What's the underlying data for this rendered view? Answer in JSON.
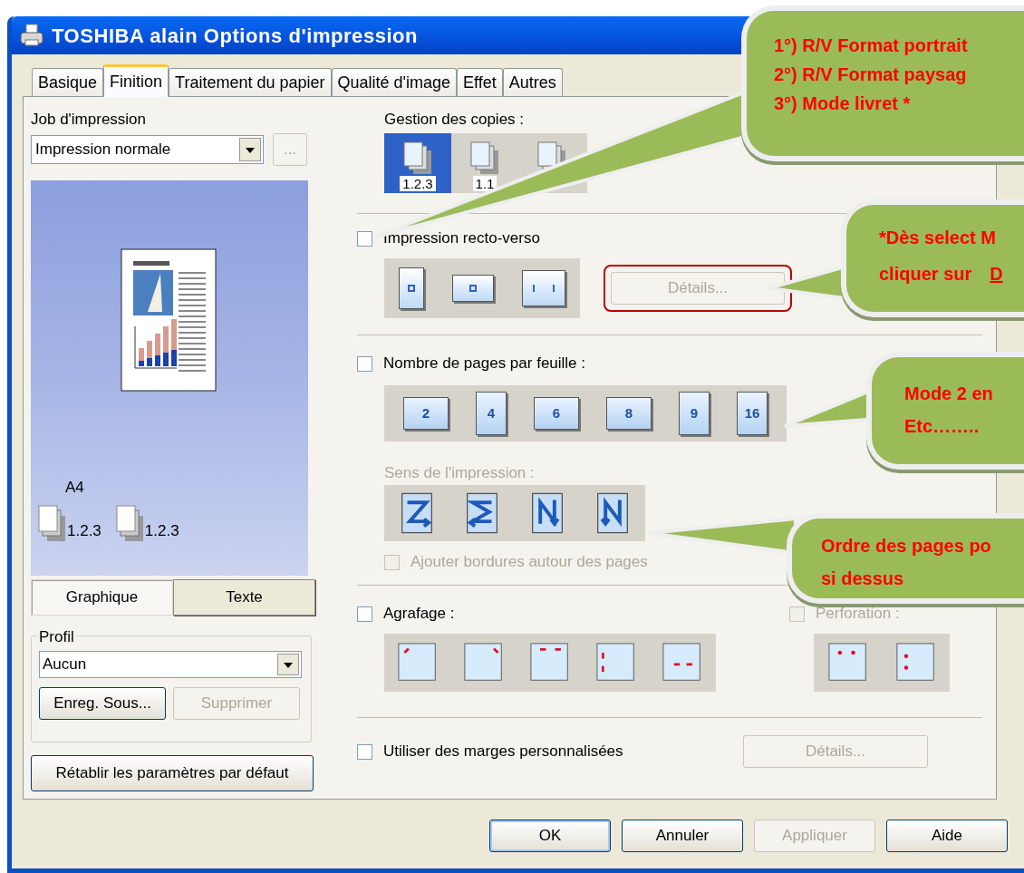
{
  "window": {
    "title": "TOSHIBA alain Options d'impression"
  },
  "tabs": [
    {
      "label": "Basique",
      "selected": false
    },
    {
      "label": "Finition",
      "selected": true
    },
    {
      "label": "Traitement du papier",
      "selected": false
    },
    {
      "label": "Qualité d'image",
      "selected": false
    },
    {
      "label": "Effet",
      "selected": false
    },
    {
      "label": "Autres",
      "selected": false
    }
  ],
  "job": {
    "label": "Job d'impression",
    "value": "Impression normale",
    "more_button": {
      "label": "...",
      "disabled": true
    }
  },
  "preview": {
    "paper_size": "A4",
    "copy_labels": [
      "1.2.3",
      "1.2.3"
    ]
  },
  "view_tabs": [
    {
      "label": "Graphique",
      "selected": true
    },
    {
      "label": "Texte",
      "selected": false
    }
  ],
  "profile": {
    "label": "Profil",
    "value": "Aucun",
    "buttons": [
      {
        "label": "Enreg. Sous...",
        "disabled": false
      },
      {
        "label": "Supprimer",
        "disabled": true
      }
    ]
  },
  "reset_button": {
    "label": "Rétablir les paramètres par défaut"
  },
  "copies": {
    "label": "Gestion des copies :",
    "options": [
      {
        "label": "1.2.3",
        "selected": true
      },
      {
        "label": "1.1",
        "selected": false
      },
      {
        "selected": false
      }
    ]
  },
  "duplex": {
    "label": "Impression recto-verso",
    "checked": false,
    "details_button": {
      "label": "Détails...",
      "disabled": true,
      "highlighted": true
    }
  },
  "nup": {
    "label": "Nombre de pages par feuille :",
    "checked": false,
    "options": [
      "2",
      "4",
      "6",
      "8",
      "9",
      "16"
    ]
  },
  "order": {
    "label": "Sens de l'impression :",
    "disabled": true
  },
  "borders": {
    "label": "Ajouter bordures autour des pages",
    "checked": false,
    "disabled": true
  },
  "stapling": {
    "label": "Agrafage :",
    "checked": false
  },
  "punch": {
    "label": "Perforation :",
    "checked": false,
    "disabled": true
  },
  "margins": {
    "label": "Utiliser des marges personnalisées",
    "checked": false,
    "details_button": {
      "label": "Détails...",
      "disabled": true,
      "highlighted": false
    }
  },
  "footer_buttons": [
    {
      "label": "OK",
      "disabled": false,
      "default": true
    },
    {
      "label": "Annuler",
      "disabled": false,
      "default": false
    },
    {
      "label": "Appliquer",
      "disabled": true,
      "default": false
    },
    {
      "label": "Aide",
      "disabled": false,
      "default": false
    }
  ],
  "callouts": [
    {
      "lines": [
        {
          "text": "1°) R/V Format portrait"
        },
        {
          "text": "2°) R/V Format paysag"
        },
        {
          "text": "3°) Mode livret *"
        }
      ]
    },
    {
      "lines": [
        {
          "text": "*Dès select M"
        },
        {
          "text": "cliquer sur",
          "link": "D"
        }
      ]
    },
    {
      "lines": [
        {
          "text": "Mode 2 en"
        },
        {
          "text": "Etc…….."
        }
      ]
    },
    {
      "lines": [
        {
          "text": "Ordre des pages po"
        },
        {
          "text": "si dessus"
        }
      ]
    }
  ]
}
